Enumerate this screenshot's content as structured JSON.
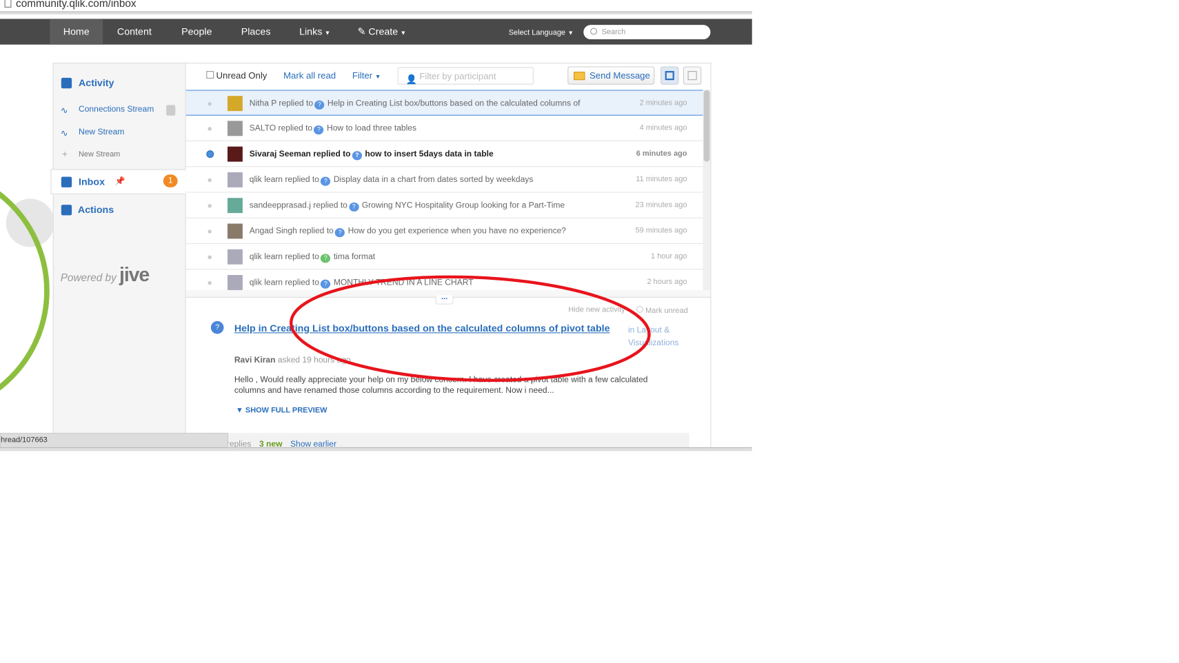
{
  "browser": {
    "url": "community.qlik.com/inbox",
    "status_url": "hread/107663"
  },
  "nav": {
    "items": [
      "Home",
      "Content",
      "People",
      "Places",
      "Links",
      "Create"
    ],
    "language": "Select Language",
    "search_placeholder": "Search"
  },
  "sidebar": {
    "activity": "Activity",
    "connections_stream": "Connections Stream",
    "new_stream": "New Stream",
    "new_stream_add": "New Stream",
    "inbox": "Inbox",
    "inbox_count": "1",
    "actions": "Actions",
    "powered_by": "Powered by",
    "brand": "jive"
  },
  "toolbar": {
    "unread_only": "Unread Only",
    "mark_all_read": "Mark all read",
    "filter": "Filter",
    "filter_placeholder": "Filter by participant",
    "send_message": "Send Message"
  },
  "rows": [
    {
      "user": "Nitha P",
      "action": "replied to",
      "title": "Help in Creating List box/buttons based on the calculated columns of",
      "time": "2 minutes ago",
      "unread": false,
      "selected": true
    },
    {
      "user": "SALTO",
      "action": "replied to",
      "title": "How to load three tables",
      "time": "4 minutes ago"
    },
    {
      "user": "Sivaraj Seeman",
      "action": "replied to",
      "title": "how to insert 5days data in table",
      "time": "6 minutes ago",
      "unread": true
    },
    {
      "user": "qlik learn",
      "action": "replied to",
      "title": "Display data in a chart from dates sorted by weekdays",
      "time": "11 minutes ago"
    },
    {
      "user": "sandeepprasad.j",
      "action": "replied to",
      "title": "Growing NYC Hospitality Group looking for a Part-Time",
      "time": "23 minutes ago"
    },
    {
      "user": "Angad Singh",
      "action": "replied to",
      "title": "How  do you get experience when you have no experience?",
      "time": "59 minutes ago"
    },
    {
      "user": "qlik learn",
      "action": "replied to",
      "title": "tima format",
      "time": "1 hour ago",
      "answered": true
    },
    {
      "user": "qlik learn",
      "action": "replied to",
      "title": "MONTHLY TREND  IN A LINE CHART",
      "time": "2 hours ago"
    }
  ],
  "preview": {
    "hide_new_activity": "Hide new activity",
    "mark_unread": "Mark unread",
    "title": "Help in Creating List box/buttons based on the calculated columns of pivot table",
    "in": "in",
    "place": "Layout & Visualizations",
    "author": "Ravi Kiran",
    "asked": "asked 19 hours ago",
    "body": "Hello , Would really appreciate your help on my below concern. I have created a pivot table with a few calculated columns and have renamed those columns according to the requirement. Now i need...",
    "show_full": "SHOW FULL PREVIEW",
    "replies": "replies",
    "new_count": "3 new",
    "show_earlier": "Show earlier"
  },
  "colors": {
    "accent": "#2a6ebb",
    "nav": "#494949",
    "badge": "#f08a24",
    "annotation": "#e8141c"
  }
}
